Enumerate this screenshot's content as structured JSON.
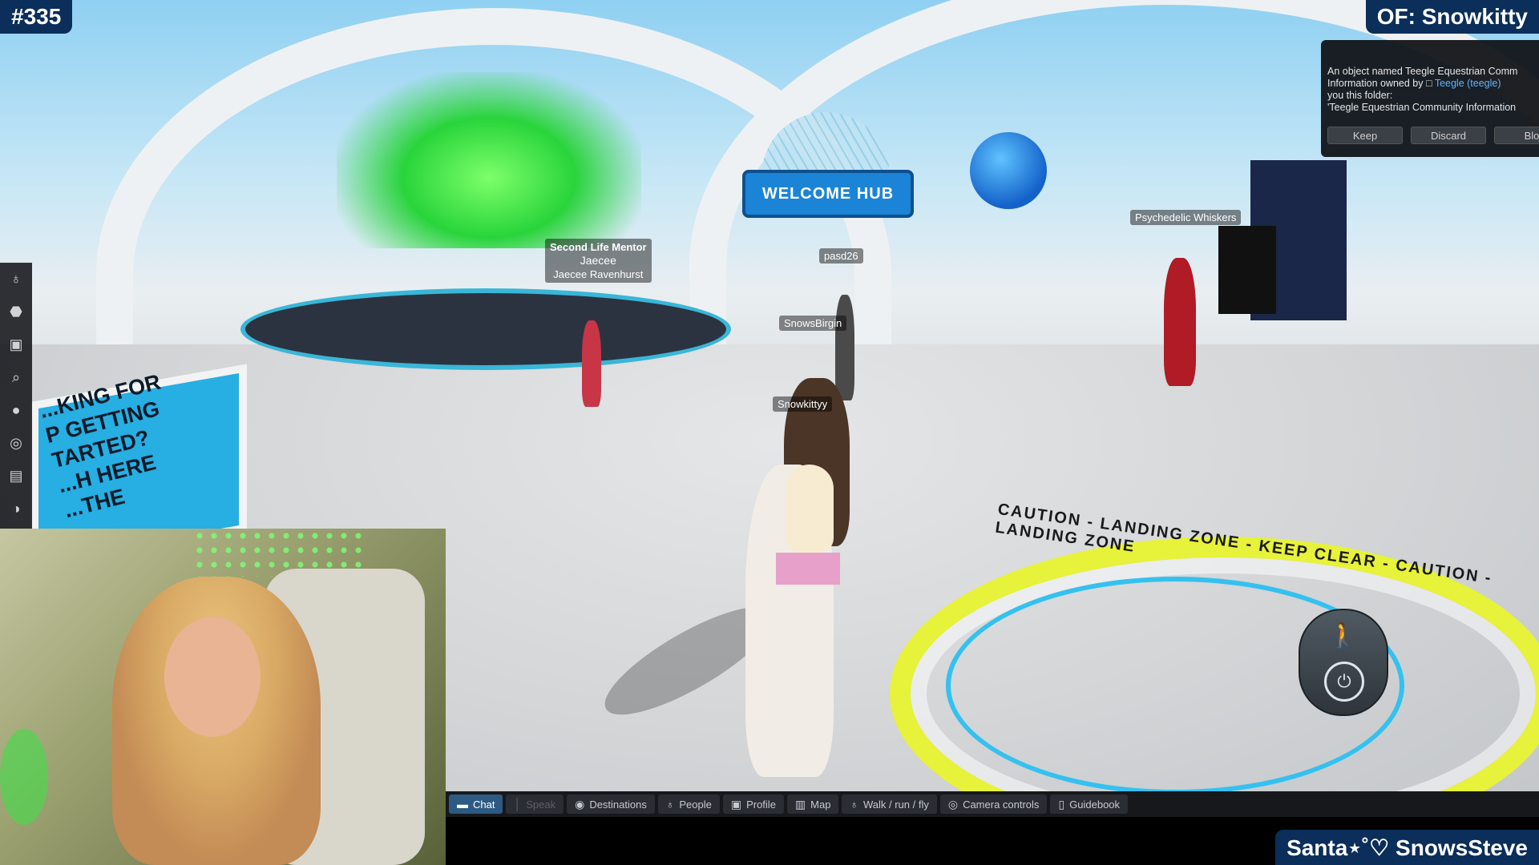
{
  "overlay": {
    "episode": "#335",
    "of_label": "OF: Snowkitty",
    "bottom_right": "Santa⋆˚♡ SnowsSteve"
  },
  "notification": {
    "line1": "An object named Teegle Equestrian Comm",
    "line2_prefix": "Information owned by",
    "owner": "Teegle (teegle)",
    "line3": "you this folder:",
    "line4": "'Teegle Equestrian Community Information",
    "buttons": [
      "Keep",
      "Discard",
      "Blo"
    ]
  },
  "scene": {
    "welcome_sign": "WELCOME HUB",
    "left_sign": "...KING FOR\nP GETTING\nTARTED?\n...H HERE\n...THE",
    "landing_ring": "CAUTION - LANDING ZONE - KEEP CLEAR - CAUTION - LANDING ZONE"
  },
  "nametags": {
    "mentor_role": "Second Life Mentor",
    "mentor_name": "Jaecee",
    "mentor_full": "Jaecee Ravenhurst",
    "pasd": "pasd26",
    "snowsbirgin": "SnowsBirgin",
    "snowkittyy": "Snowkittyy",
    "whiskers": "Psychedelic Whiskers"
  },
  "left_toolbar": [
    {
      "icon": "people-icon",
      "glyph": "♁"
    },
    {
      "icon": "shirt-icon",
      "glyph": "⬣"
    },
    {
      "icon": "inventory-icon",
      "glyph": "▣"
    },
    {
      "icon": "search-icon",
      "glyph": "⌕"
    },
    {
      "icon": "lightbulb-icon",
      "glyph": "●"
    },
    {
      "icon": "radio-icon",
      "glyph": "◎"
    },
    {
      "icon": "camera-icon",
      "glyph": "▤"
    },
    {
      "icon": "speedometer-icon",
      "glyph": "◑"
    }
  ],
  "bottom_toolbar": {
    "chat": "Chat",
    "speak": "Speak",
    "destinations": "Destinations",
    "people": "People",
    "profile": "Profile",
    "map": "Map",
    "walk": "Walk / run / fly",
    "camera": "Camera controls",
    "guidebook": "Guidebook"
  },
  "colors": {
    "overlay_bg": "#0b2e5a",
    "accent_cyan": "#27aee2",
    "landing_yellow": "#e7f23a"
  }
}
